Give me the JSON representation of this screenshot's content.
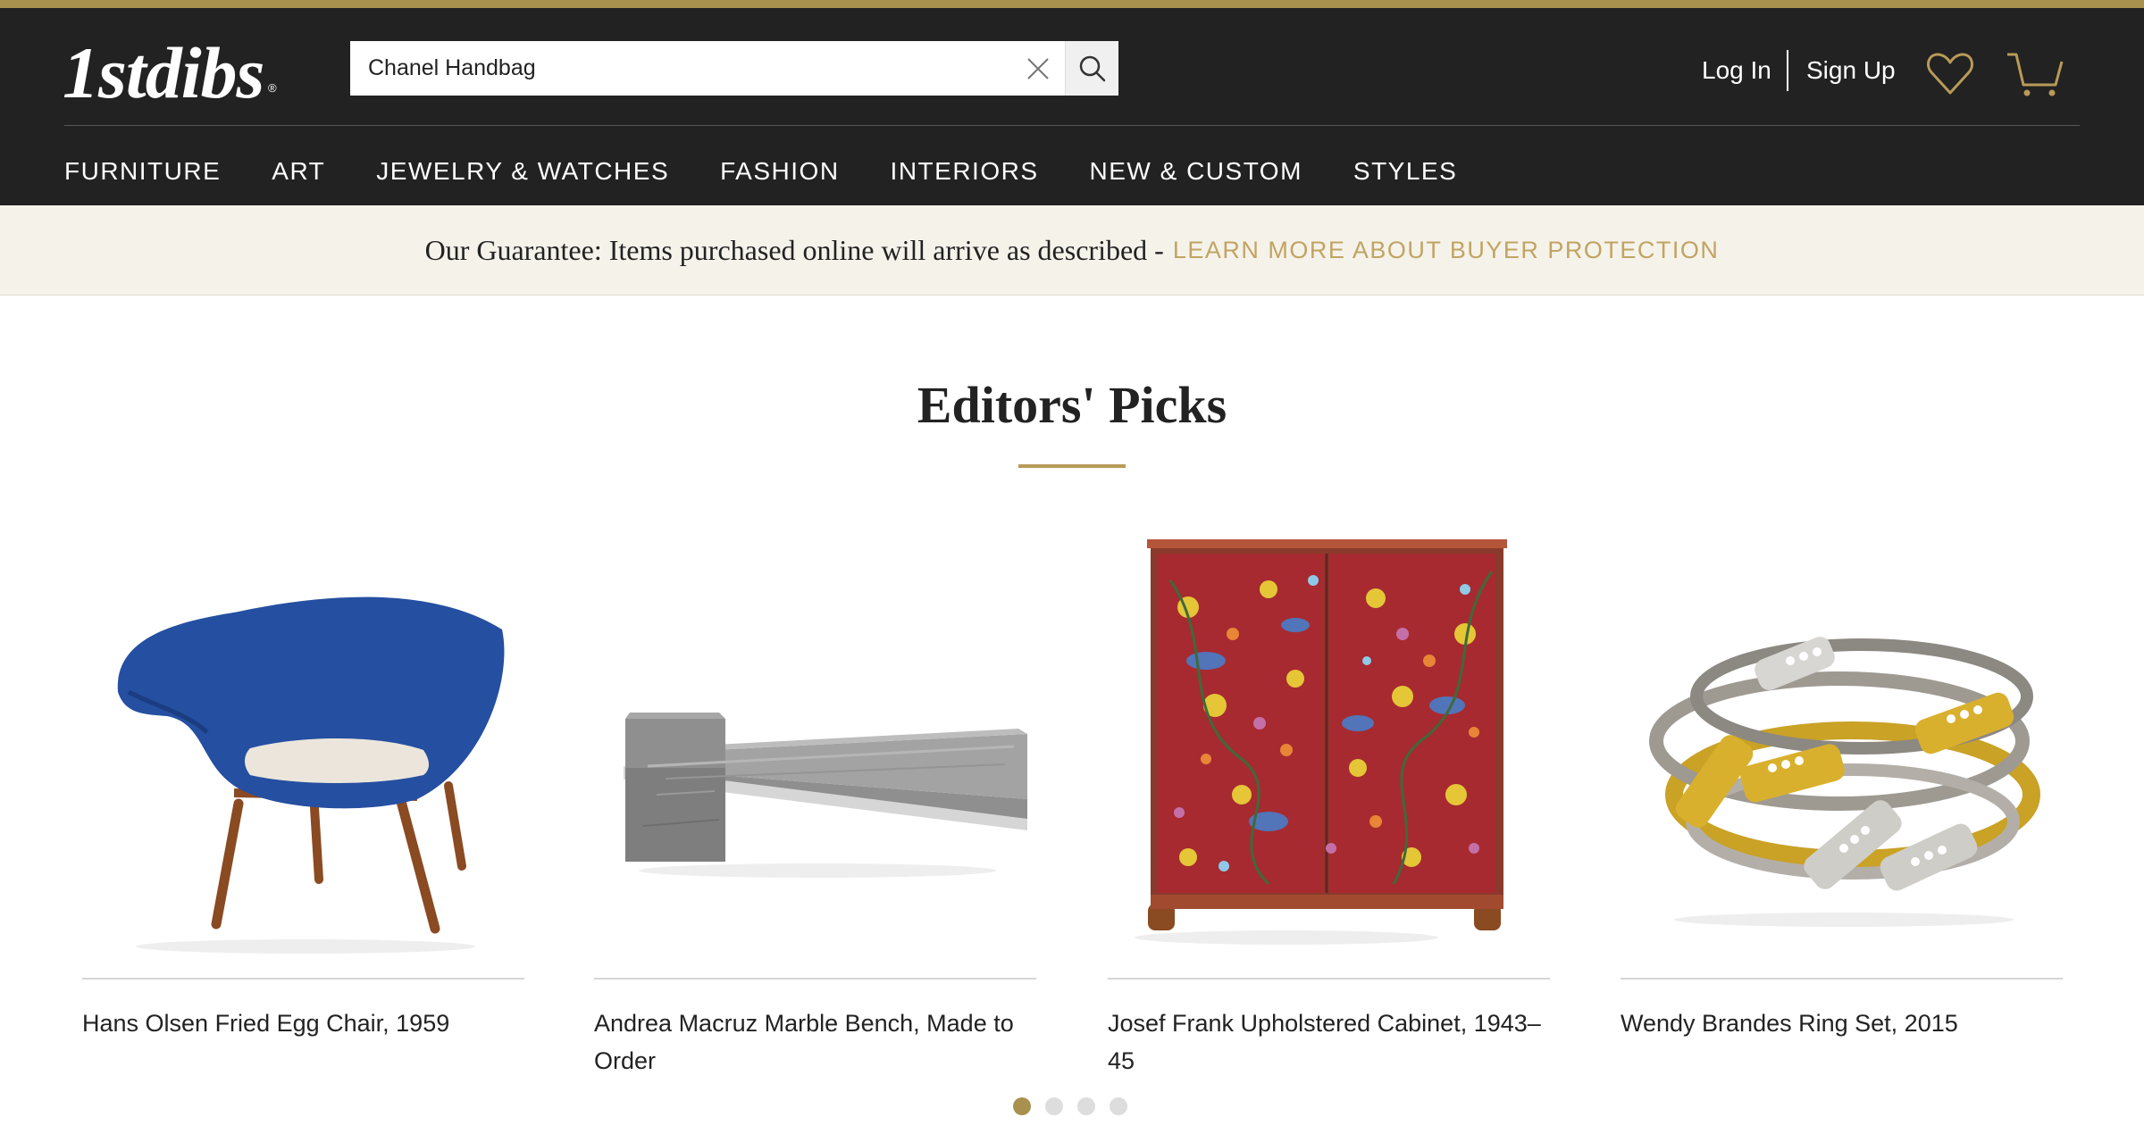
{
  "header": {
    "logo_text": "1stdibs",
    "logo_registered": "®",
    "search": {
      "value": "Chanel Handbag",
      "placeholder": ""
    },
    "login_label": "Log In",
    "signup_label": "Sign Up"
  },
  "nav": {
    "items": [
      "FURNITURE",
      "ART",
      "JEWELRY & WATCHES",
      "FASHION",
      "INTERIORS",
      "NEW & CUSTOM",
      "STYLES"
    ]
  },
  "guarantee": {
    "text": "Our Guarantee: Items purchased online will arrive as described -",
    "link": "LEARN MORE ABOUT BUYER PROTECTION"
  },
  "editors_picks": {
    "title": "Editors' Picks",
    "items": [
      {
        "caption": "Hans Olsen Fried Egg Chair, 1959",
        "icon": "chair-image"
      },
      {
        "caption": "Andrea Macruz Marble Bench, Made to Order",
        "icon": "bench-image"
      },
      {
        "caption": "Josef Frank Upholstered Cabinet, 1943–45",
        "icon": "cabinet-image"
      },
      {
        "caption": "Wendy Brandes Ring Set, 2015",
        "icon": "rings-image"
      }
    ],
    "pagination": {
      "pages": 4,
      "active": 1
    }
  },
  "colors": {
    "accent_gold": "#a8914f",
    "link_gold": "#c1a462",
    "header_bg": "#222222",
    "banner_bg": "#f5f2ea"
  }
}
